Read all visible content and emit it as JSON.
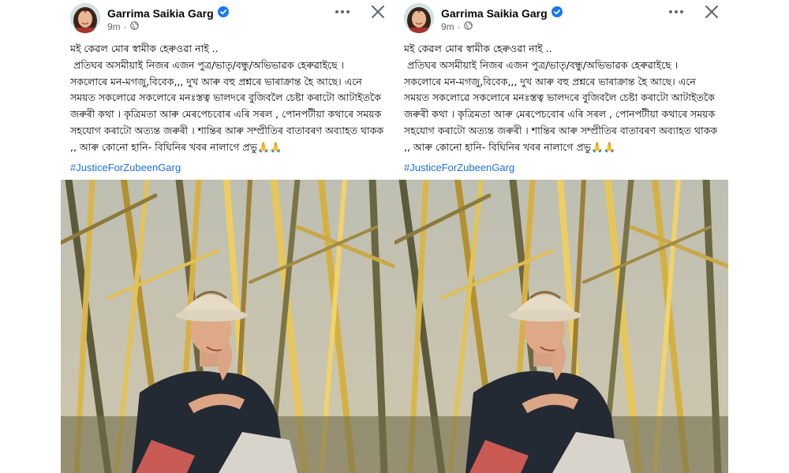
{
  "post": {
    "author": "Garrima Saikia Garg",
    "time": "9m",
    "paragraphs": [
      "মই কেৱল মোৰ স্বামীক হেৰুওৱা নাই ..",
      " প্ৰতিঘৰ অসমীয়াই নিজৰ এজন পুত্ৰ/ভাতৃ/বন্ধু/অভিভাৱক হেৰুৱাইছে ।",
      "সকলোৰে মন-মগজু,বিবেক,,, দুখ আৰু বহু প্ৰশ্নৰে ভাৰাক্ৰান্ত হৈ আছে। এনে সময়ত সকলোৱে সকলোৰে মনঃস্তত্ব ভালদৰে বুজিবলৈ চেষ্টা কৰাটো আটাইতকৈ জৰুৰী কথা । কৃত্ৰিমতা আৰু মেৰপেচবোৰ এৰি সৰল , পোনপটীয়া কথাৰে সময়ক সহযোগ কৰাটো অত্যন্ত জৰুৰী । শান্তিৰ আৰু সম্প্ৰীতিৰ বাতাবৰণ অব্যাহত থাকক ,, আৰু কোনো হানি- বিঘিনিৰ খবৰ নালাগে প্ৰভু🙏🙏"
    ],
    "hashtag": "#JusticeForZubeenGarg"
  },
  "icons": {
    "verified": "verified-badge-icon",
    "audience": "globe-icon",
    "more": "more-options-icon",
    "close": "close-icon"
  },
  "colors": {
    "verified": "#1877f2",
    "hashtag": "#216fdb",
    "meta": "#65676b"
  }
}
